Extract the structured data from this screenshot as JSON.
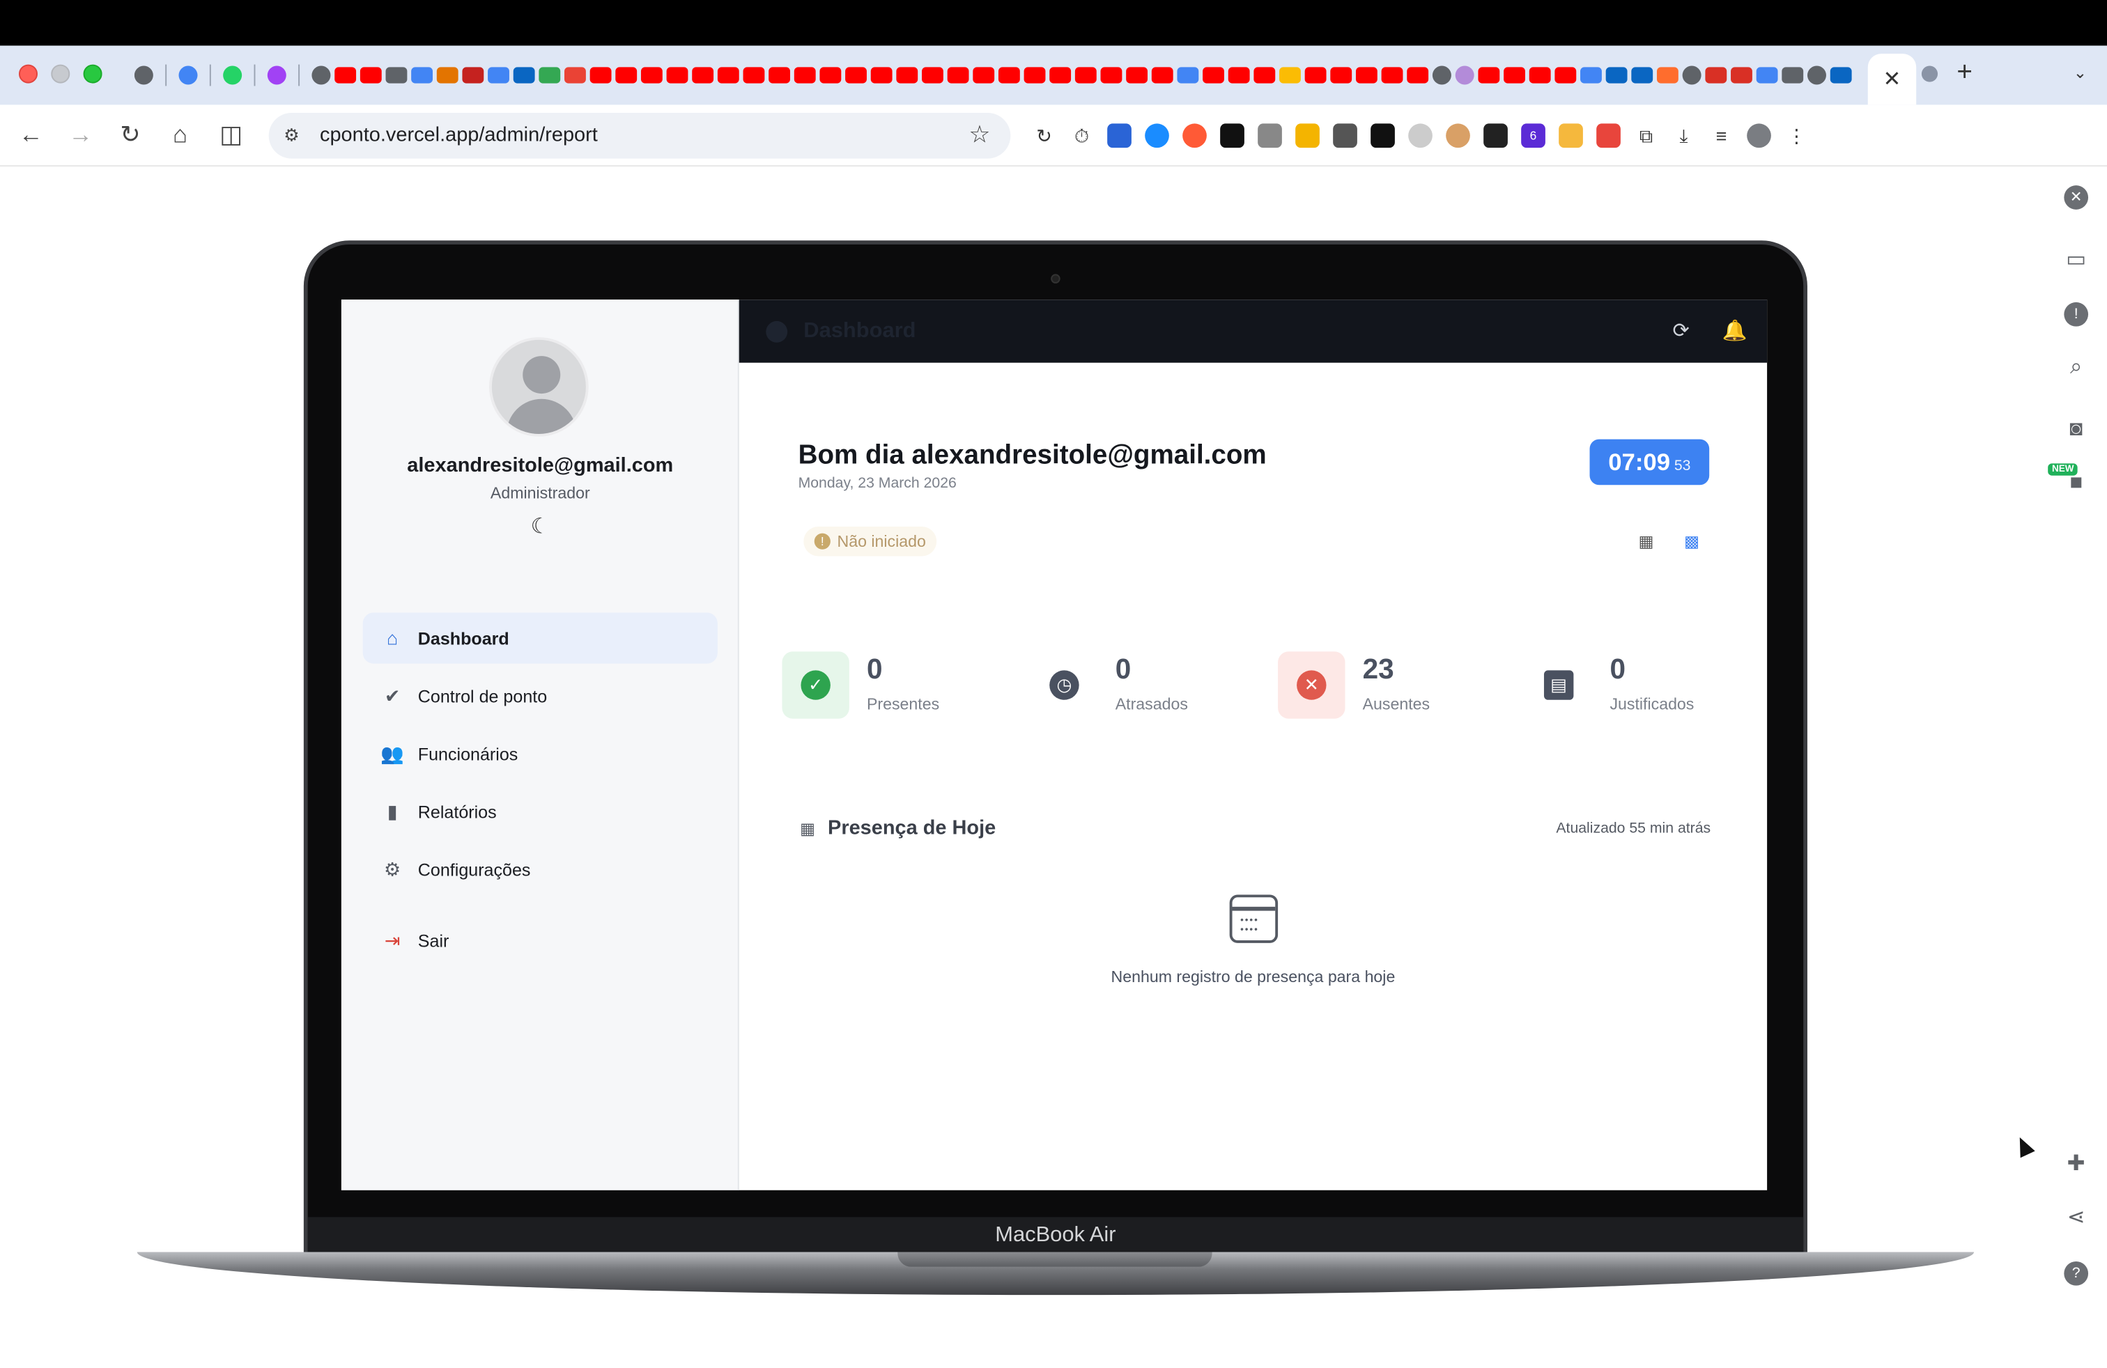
{
  "browser": {
    "url": "cponto.vercel.app/admin/report",
    "active_tab_close": "✕",
    "new_tab": "+",
    "tab_menu": "⌄",
    "nav": {
      "back_icon": "arrow-left-icon",
      "forward_icon": "arrow-right-icon",
      "reload_icon": "reload-icon",
      "home_icon": "home-icon",
      "split_icon": "split-view-icon"
    },
    "extension_badge": "6"
  },
  "device": {
    "label": "MacBook Air"
  },
  "app": {
    "sidebar": {
      "user_email": "alexandresitole@gmail.com",
      "user_role": "Administrador",
      "theme_icon": "☾",
      "items": [
        {
          "label": "Dashboard",
          "icon": "⌂",
          "active": true
        },
        {
          "label": "Control de ponto",
          "icon": "✔"
        },
        {
          "label": "Funcionários",
          "icon": "👥"
        },
        {
          "label": "Relatórios",
          "icon": "▮"
        },
        {
          "label": "Configurações",
          "icon": "⚙"
        },
        {
          "label": "Sair",
          "icon": "⇥"
        }
      ]
    },
    "topbar": {
      "title": "Dashboard",
      "refresh_icon": "⟳",
      "bell_icon": "🔔"
    },
    "greeting": "Bom dia alexandresitole@gmail.com",
    "date": "Monday, 23 March 2026",
    "clock": {
      "time": "07:09",
      "seconds": "53"
    },
    "status": {
      "icon": "!",
      "text": "Não iniciado"
    },
    "stats": [
      {
        "value": "0",
        "label": "Presentes",
        "icon": "✓",
        "color": "#2ea44f",
        "bg": "#e6f6ea"
      },
      {
        "value": "0",
        "label": "Atrasados",
        "icon": "◷",
        "color": "#4a5160",
        "bg": "#ffffff"
      },
      {
        "value": "23",
        "label": "Ausentes",
        "icon": "✕",
        "color": "#e05a4e",
        "bg": "#fde8e6"
      },
      {
        "value": "0",
        "label": "Justificados",
        "icon": "▤",
        "color": "#4a5160",
        "bg": "#ffffff"
      }
    ],
    "presence": {
      "title": "Presença de Hoje",
      "updated": "Atualizado 55 min atrás",
      "empty": "Nenhum registro de presença para hoje"
    }
  },
  "colors": {
    "accent": "#3d82f2",
    "sidebar_active_bg": "#e9effb",
    "danger": "#d9443a"
  }
}
